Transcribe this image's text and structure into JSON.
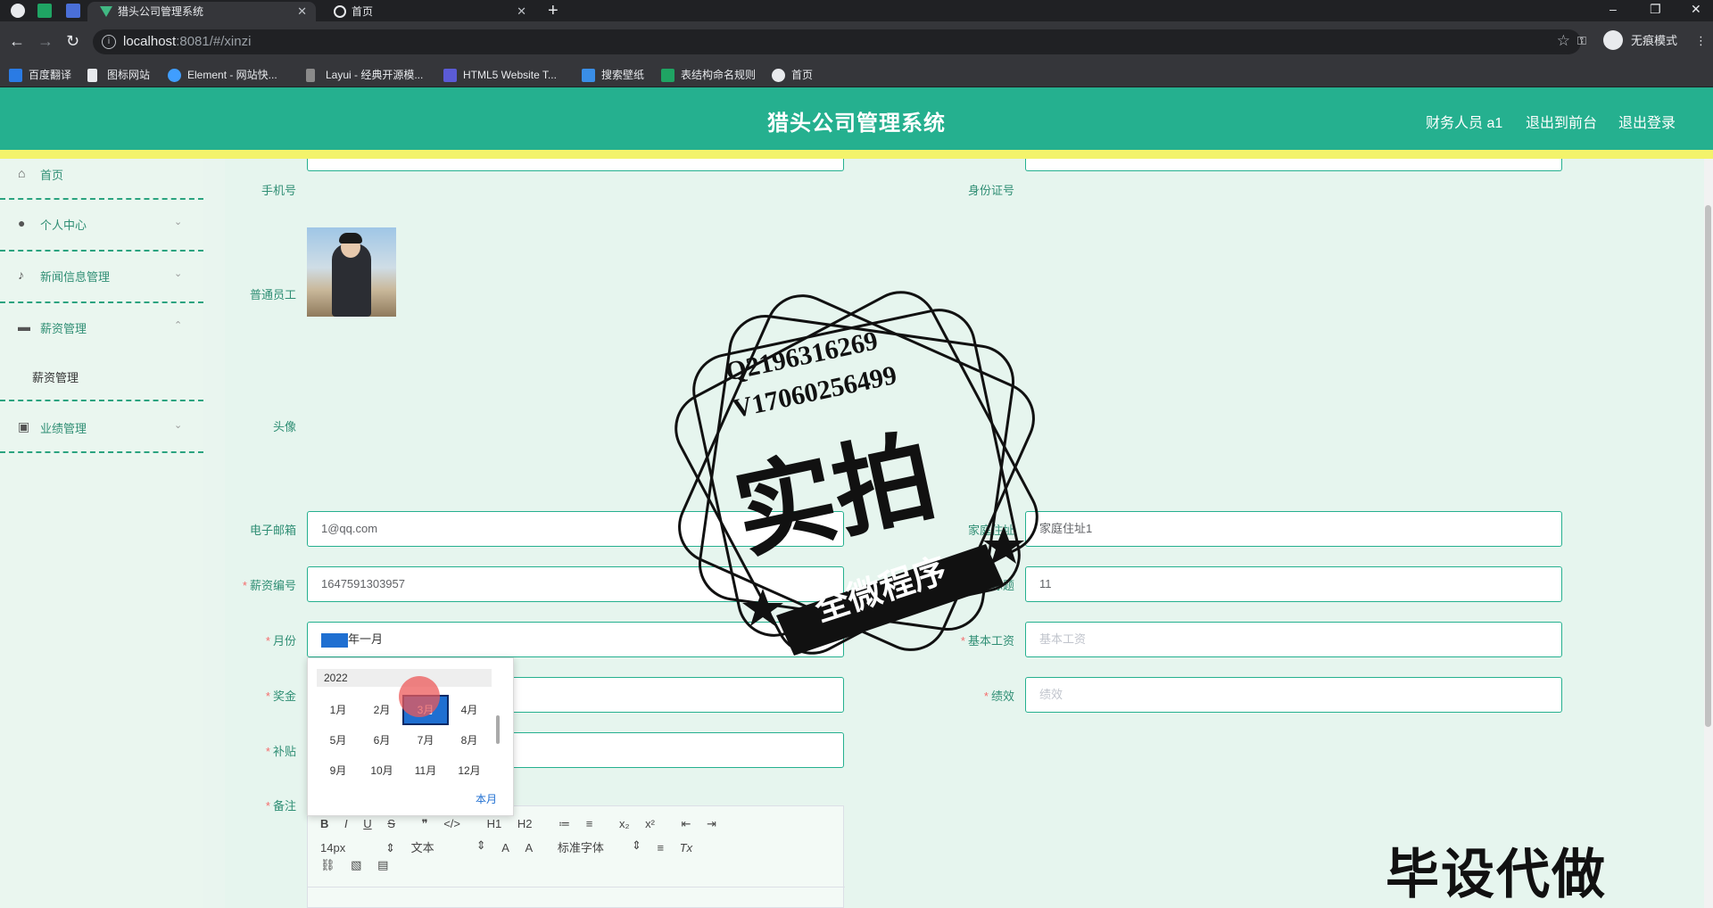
{
  "browser": {
    "tabs": [
      {
        "title": "猎头公司管理系统",
        "active": true
      },
      {
        "title": "首页",
        "active": false
      }
    ],
    "url_host": "localhost",
    "url_rest": ":8081/#/xinzi",
    "incognito_label": "无痕模式",
    "bookmarks": [
      "百度翻译",
      "图标网站",
      "Element - 网站快...",
      "Layui - 经典开源模...",
      "HTML5 Website T...",
      "搜索壁纸",
      "表结构命名规则",
      "首页"
    ]
  },
  "header": {
    "title": "猎头公司管理系统",
    "user": "财务人员 a1",
    "to_front": "退出到前台",
    "logout": "退出登录",
    "color": "#25b08f"
  },
  "sidebar": {
    "items": [
      {
        "label": "首页",
        "icon": "home-icon"
      },
      {
        "label": "个人中心",
        "icon": "user-icon"
      },
      {
        "label": "新闻信息管理",
        "icon": "mic-icon"
      },
      {
        "label": "薪资管理",
        "icon": "wallet-icon",
        "expanded": true
      },
      {
        "label": "业绩管理",
        "icon": "clipboard-icon"
      }
    ],
    "sub_items": [
      "薪资管理"
    ]
  },
  "form": {
    "phone_label": "手机号",
    "idcard_label": "身份证号",
    "employee_label": "普通员工",
    "avatar_label": "头像",
    "email_label": "电子邮箱",
    "email_value": "1@qq.com",
    "address_label": "家庭住址",
    "address_value": "家庭住址1",
    "salary_no_label": "薪资编号",
    "salary_no_value": "1647591303957",
    "title_label": "标题",
    "title_value": "11",
    "month_label": "月份",
    "month_value_suffix": "年一月",
    "base_salary_label": "基本工资",
    "base_salary_placeholder": "基本工资",
    "bonus_label": "奖金",
    "performance_label": "绩效",
    "performance_placeholder": "绩效",
    "allowance_label": "补贴",
    "remark_label": "备注"
  },
  "month_picker": {
    "year": "2022",
    "months": [
      "1月",
      "2月",
      "3月",
      "4月",
      "5月",
      "6月",
      "7月",
      "8月",
      "9月",
      "10月",
      "11月",
      "12月"
    ],
    "selected_index": 2,
    "this_month": "本月"
  },
  "editor": {
    "row1": [
      "B",
      "I",
      "U",
      "S",
      "❞",
      "</>",
      "H1",
      "H2",
      "≔",
      "≡",
      "x₂",
      "x²",
      "⇤",
      "⇥"
    ],
    "font_size": "14px",
    "block_type": "文本",
    "font_family": "标准字体",
    "clear": "Tx"
  },
  "watermark": {
    "qq": "Q2196316269",
    "vx": "V17060256499",
    "big": "实拍",
    "banner": "全微程序",
    "bottom": "毕设代做"
  }
}
